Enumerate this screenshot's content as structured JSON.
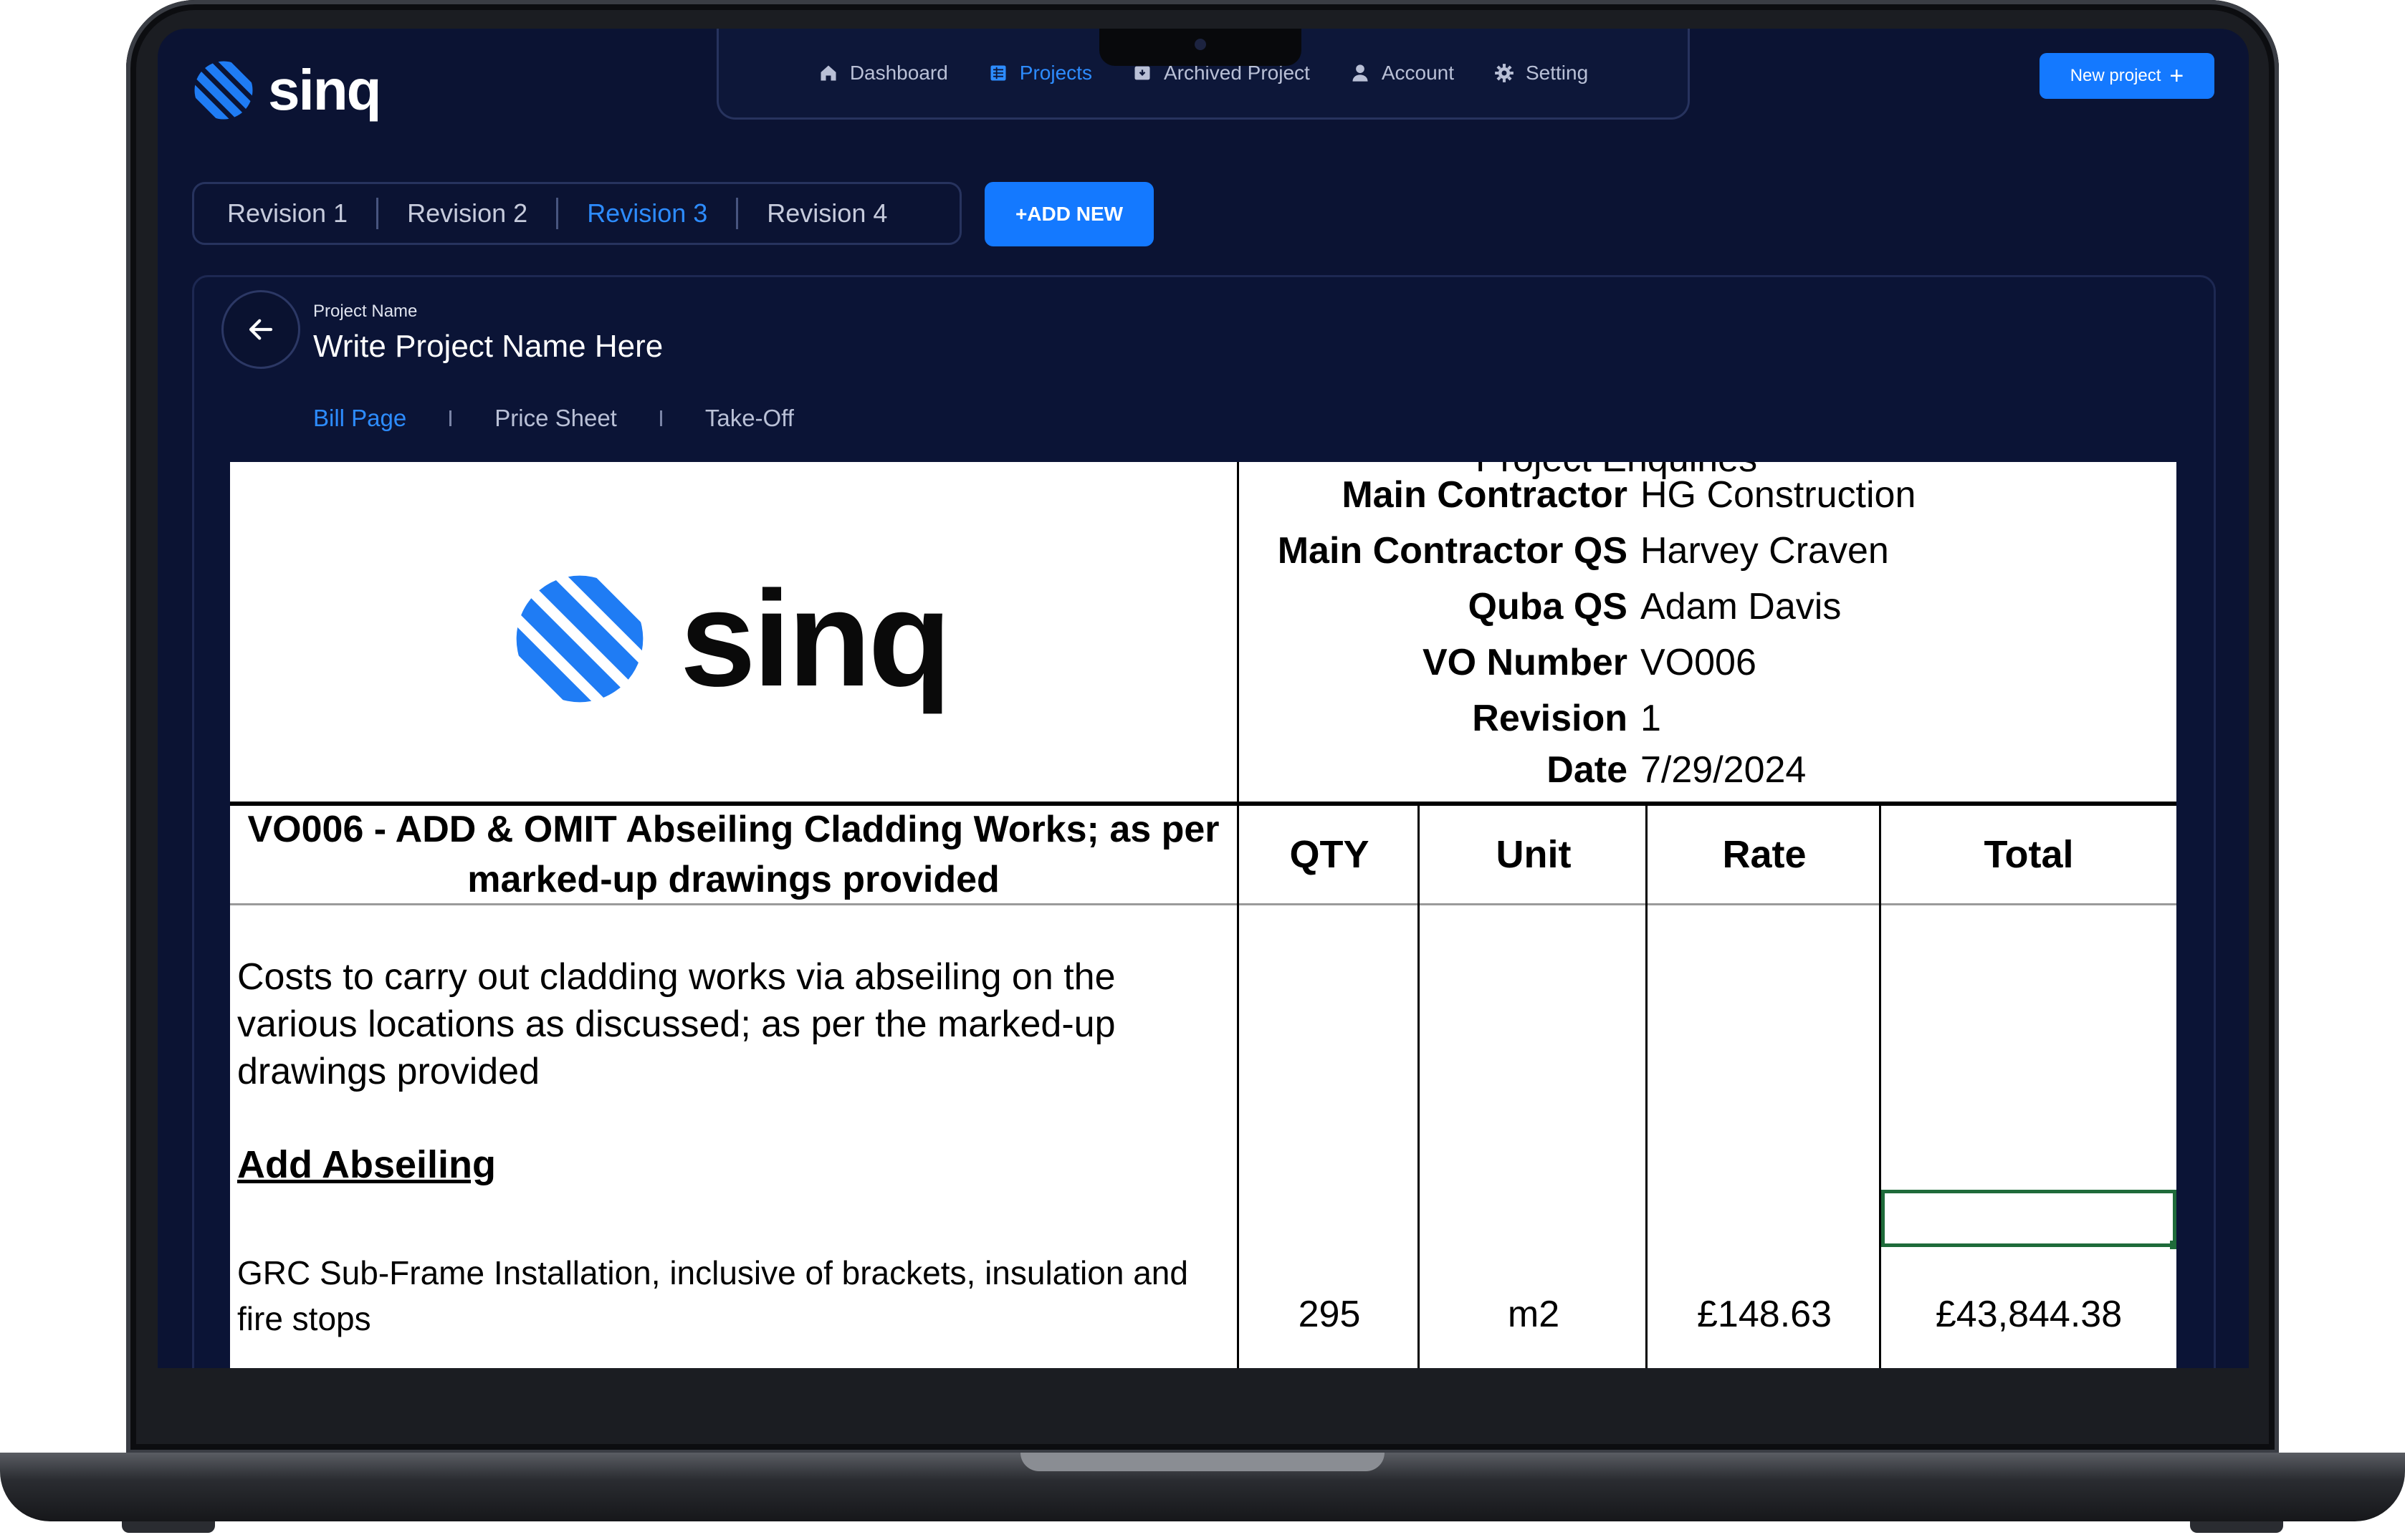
{
  "app": {
    "logo_text": "sinq",
    "new_project_label": "New project",
    "new_project_icon": "plus-icon"
  },
  "nav": {
    "items": [
      {
        "label": "Dashboard",
        "icon": "home-icon"
      },
      {
        "label": "Projects",
        "icon": "grid-icon",
        "active": true
      },
      {
        "label": "Archived Project",
        "icon": "archive-icon"
      },
      {
        "label": "Account",
        "icon": "user-icon"
      },
      {
        "label": "Setting",
        "icon": "gear-icon"
      }
    ]
  },
  "revisions": {
    "tabs": [
      "Revision 1",
      "Revision 2",
      "Revision 3",
      "Revision 4"
    ],
    "active": "Revision 3",
    "add_label": "+ADD NEW"
  },
  "project": {
    "name_label": "Project Name",
    "name_value": "Write Project Name Here",
    "tabs": [
      "Bill Page",
      "Price Sheet",
      "Take-Off"
    ],
    "active_tab": "Bill Page"
  },
  "sheet": {
    "logo_text": "sinq",
    "clipped_row": "Project Enquiries",
    "meta": [
      {
        "label": "Main Contractor",
        "value": "HG Construction"
      },
      {
        "label": "Main Contractor QS",
        "value": "Harvey Craven"
      },
      {
        "label": "Quba QS",
        "value": "Adam Davis"
      },
      {
        "label": "VO Number",
        "value": "VO006"
      },
      {
        "label": "Revision",
        "value": "1"
      },
      {
        "label": "Date",
        "value": "7/29/2024"
      }
    ],
    "description_header": "VO006 - ADD & OMIT Abseiling Cladding Works; as per marked-up drawings provided",
    "columns": [
      "QTY",
      "Unit",
      "Rate",
      "Total"
    ],
    "intro_text": "Costs to carry out cladding works via abseiling on the various locations as discussed; as per the marked-up drawings provided",
    "section_heading": "Add Abseiling",
    "item": {
      "description": "GRC Sub-Frame Installation, inclusive of brackets, insulation and fire stops",
      "qty": "295",
      "unit": "m2",
      "rate": "£148.63",
      "total": "£43,844.38"
    }
  },
  "colors": {
    "accent": "#1479ff",
    "screen_bg": "#0b1333",
    "brand_blue": "#1f7cf4"
  }
}
